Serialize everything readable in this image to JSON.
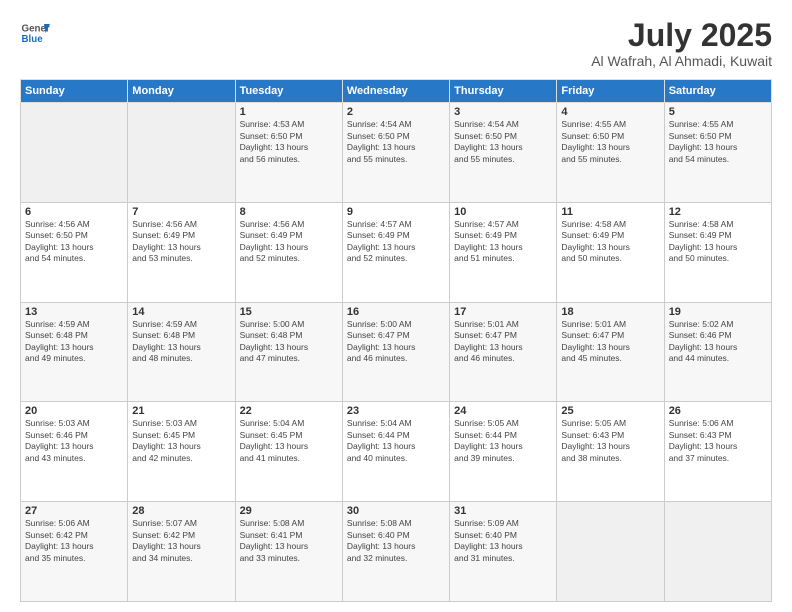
{
  "header": {
    "logo_line1": "General",
    "logo_line2": "Blue",
    "month": "July 2025",
    "location": "Al Wafrah, Al Ahmadi, Kuwait"
  },
  "weekdays": [
    "Sunday",
    "Monday",
    "Tuesday",
    "Wednesday",
    "Thursday",
    "Friday",
    "Saturday"
  ],
  "weeks": [
    [
      {
        "day": "",
        "info": ""
      },
      {
        "day": "",
        "info": ""
      },
      {
        "day": "1",
        "info": "Sunrise: 4:53 AM\nSunset: 6:50 PM\nDaylight: 13 hours\nand 56 minutes."
      },
      {
        "day": "2",
        "info": "Sunrise: 4:54 AM\nSunset: 6:50 PM\nDaylight: 13 hours\nand 55 minutes."
      },
      {
        "day": "3",
        "info": "Sunrise: 4:54 AM\nSunset: 6:50 PM\nDaylight: 13 hours\nand 55 minutes."
      },
      {
        "day": "4",
        "info": "Sunrise: 4:55 AM\nSunset: 6:50 PM\nDaylight: 13 hours\nand 55 minutes."
      },
      {
        "day": "5",
        "info": "Sunrise: 4:55 AM\nSunset: 6:50 PM\nDaylight: 13 hours\nand 54 minutes."
      }
    ],
    [
      {
        "day": "6",
        "info": "Sunrise: 4:56 AM\nSunset: 6:50 PM\nDaylight: 13 hours\nand 54 minutes."
      },
      {
        "day": "7",
        "info": "Sunrise: 4:56 AM\nSunset: 6:49 PM\nDaylight: 13 hours\nand 53 minutes."
      },
      {
        "day": "8",
        "info": "Sunrise: 4:56 AM\nSunset: 6:49 PM\nDaylight: 13 hours\nand 52 minutes."
      },
      {
        "day": "9",
        "info": "Sunrise: 4:57 AM\nSunset: 6:49 PM\nDaylight: 13 hours\nand 52 minutes."
      },
      {
        "day": "10",
        "info": "Sunrise: 4:57 AM\nSunset: 6:49 PM\nDaylight: 13 hours\nand 51 minutes."
      },
      {
        "day": "11",
        "info": "Sunrise: 4:58 AM\nSunset: 6:49 PM\nDaylight: 13 hours\nand 50 minutes."
      },
      {
        "day": "12",
        "info": "Sunrise: 4:58 AM\nSunset: 6:49 PM\nDaylight: 13 hours\nand 50 minutes."
      }
    ],
    [
      {
        "day": "13",
        "info": "Sunrise: 4:59 AM\nSunset: 6:48 PM\nDaylight: 13 hours\nand 49 minutes."
      },
      {
        "day": "14",
        "info": "Sunrise: 4:59 AM\nSunset: 6:48 PM\nDaylight: 13 hours\nand 48 minutes."
      },
      {
        "day": "15",
        "info": "Sunrise: 5:00 AM\nSunset: 6:48 PM\nDaylight: 13 hours\nand 47 minutes."
      },
      {
        "day": "16",
        "info": "Sunrise: 5:00 AM\nSunset: 6:47 PM\nDaylight: 13 hours\nand 46 minutes."
      },
      {
        "day": "17",
        "info": "Sunrise: 5:01 AM\nSunset: 6:47 PM\nDaylight: 13 hours\nand 46 minutes."
      },
      {
        "day": "18",
        "info": "Sunrise: 5:01 AM\nSunset: 6:47 PM\nDaylight: 13 hours\nand 45 minutes."
      },
      {
        "day": "19",
        "info": "Sunrise: 5:02 AM\nSunset: 6:46 PM\nDaylight: 13 hours\nand 44 minutes."
      }
    ],
    [
      {
        "day": "20",
        "info": "Sunrise: 5:03 AM\nSunset: 6:46 PM\nDaylight: 13 hours\nand 43 minutes."
      },
      {
        "day": "21",
        "info": "Sunrise: 5:03 AM\nSunset: 6:45 PM\nDaylight: 13 hours\nand 42 minutes."
      },
      {
        "day": "22",
        "info": "Sunrise: 5:04 AM\nSunset: 6:45 PM\nDaylight: 13 hours\nand 41 minutes."
      },
      {
        "day": "23",
        "info": "Sunrise: 5:04 AM\nSunset: 6:44 PM\nDaylight: 13 hours\nand 40 minutes."
      },
      {
        "day": "24",
        "info": "Sunrise: 5:05 AM\nSunset: 6:44 PM\nDaylight: 13 hours\nand 39 minutes."
      },
      {
        "day": "25",
        "info": "Sunrise: 5:05 AM\nSunset: 6:43 PM\nDaylight: 13 hours\nand 38 minutes."
      },
      {
        "day": "26",
        "info": "Sunrise: 5:06 AM\nSunset: 6:43 PM\nDaylight: 13 hours\nand 37 minutes."
      }
    ],
    [
      {
        "day": "27",
        "info": "Sunrise: 5:06 AM\nSunset: 6:42 PM\nDaylight: 13 hours\nand 35 minutes."
      },
      {
        "day": "28",
        "info": "Sunrise: 5:07 AM\nSunset: 6:42 PM\nDaylight: 13 hours\nand 34 minutes."
      },
      {
        "day": "29",
        "info": "Sunrise: 5:08 AM\nSunset: 6:41 PM\nDaylight: 13 hours\nand 33 minutes."
      },
      {
        "day": "30",
        "info": "Sunrise: 5:08 AM\nSunset: 6:40 PM\nDaylight: 13 hours\nand 32 minutes."
      },
      {
        "day": "31",
        "info": "Sunrise: 5:09 AM\nSunset: 6:40 PM\nDaylight: 13 hours\nand 31 minutes."
      },
      {
        "day": "",
        "info": ""
      },
      {
        "day": "",
        "info": ""
      }
    ]
  ]
}
